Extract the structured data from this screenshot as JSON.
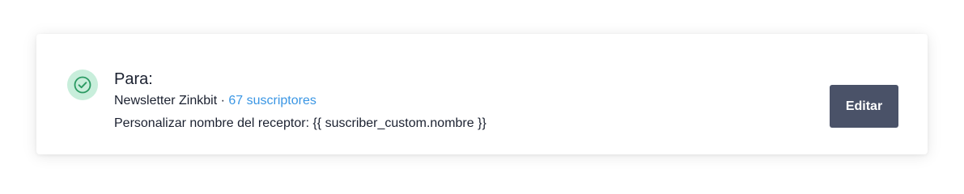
{
  "recipient": {
    "title": "Para:",
    "list_name": "Newsletter Zinkbit",
    "separator": " · ",
    "subscribers_link": "67 suscriptores",
    "personalize_text": "Personalizar nombre del receptor: {{ suscriber_custom.nombre }}",
    "status_icon": "check-circle-icon",
    "colors": {
      "icon_bg": "#c8eedb",
      "icon_stroke": "#2a9a62",
      "link": "#3a96e4",
      "button_bg": "#4a5268"
    }
  },
  "actions": {
    "edit_label": "Editar"
  }
}
